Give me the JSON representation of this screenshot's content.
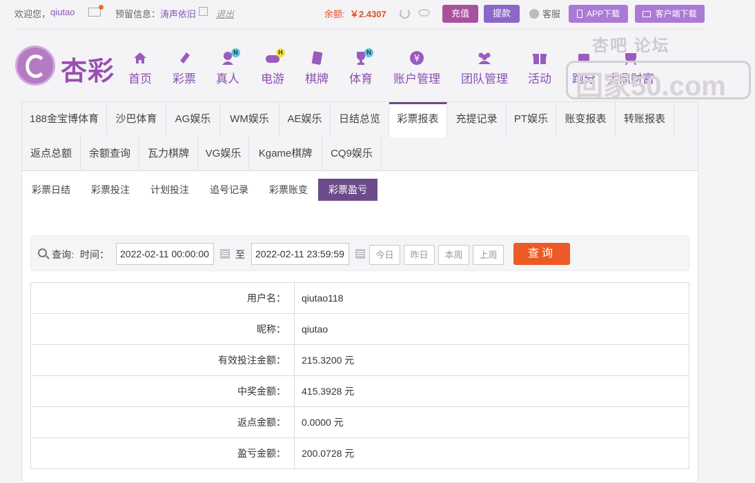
{
  "topbar": {
    "welcome": "欢迎您，",
    "username": "qiutao",
    "reserved_label": "预留信息：",
    "reserved_value": "涛声依旧",
    "logout": "退出",
    "balance_label": "余额: ",
    "balance_value": "￥2.4307",
    "recharge": "充值",
    "withdraw": "提款",
    "service": "客服",
    "app_download": "APP下载",
    "client_download": "客户端下载"
  },
  "brand": {
    "name": "杏彩",
    "accent": "#8a4fb2"
  },
  "nav": [
    {
      "label": "首页",
      "icon": "home-icon"
    },
    {
      "label": "彩票",
      "icon": "ticket-icon"
    },
    {
      "label": "真人",
      "icon": "dealer-icon",
      "badge": "N"
    },
    {
      "label": "电游",
      "icon": "gamepad-icon",
      "badge": "H"
    },
    {
      "label": "棋牌",
      "icon": "cards-icon"
    },
    {
      "label": "体育",
      "icon": "trophy-icon",
      "badge": "N"
    },
    {
      "label": "账户管理",
      "icon": "yen-icon"
    },
    {
      "label": "团队管理",
      "icon": "team-icon"
    },
    {
      "label": "活动",
      "icon": "gift-icon"
    },
    {
      "label": "跑分",
      "icon": "run-icon"
    },
    {
      "label": "金鼎财富",
      "icon": "tripod-icon"
    }
  ],
  "watermark": {
    "top": "杏吧   论坛",
    "main": "回家50.com"
  },
  "tabs_row1": [
    "188金宝博体育",
    "沙巴体育",
    "AG娱乐",
    "WM娱乐",
    "AE娱乐",
    "日结总览",
    "彩票报表",
    "充提记录",
    "PT娱乐",
    "账变报表",
    "转账报表"
  ],
  "tabs_row2": [
    "返点总额",
    "余额查询",
    "瓦力棋牌",
    "VG娱乐",
    "Kgame棋牌",
    "CQ9娱乐"
  ],
  "active_tab": "彩票报表",
  "subtabs": [
    "彩票日结",
    "彩票投注",
    "计划投注",
    "追号记录",
    "彩票账变",
    "彩票盈亏"
  ],
  "active_subtab": "彩票盈亏",
  "query": {
    "label": "查询:",
    "time_label": "时间：",
    "start": "2022-02-11 00:00:00",
    "to": "至",
    "end": "2022-02-11 23:59:59",
    "today": "今日",
    "yesterday": "昨日",
    "this_week": "本周",
    "last_week": "上周",
    "search": "查询"
  },
  "report": [
    {
      "label": "用户名：",
      "value": "qiutao118"
    },
    {
      "label": "昵称：",
      "value": "qiutao"
    },
    {
      "label": "有效投注金额：",
      "value": "215.3200 元"
    },
    {
      "label": "中奖金额：",
      "value": "415.3928 元"
    },
    {
      "label": "返点金额：",
      "value": "0.0000 元"
    },
    {
      "label": "盈亏金额：",
      "value": "200.0728 元"
    }
  ]
}
